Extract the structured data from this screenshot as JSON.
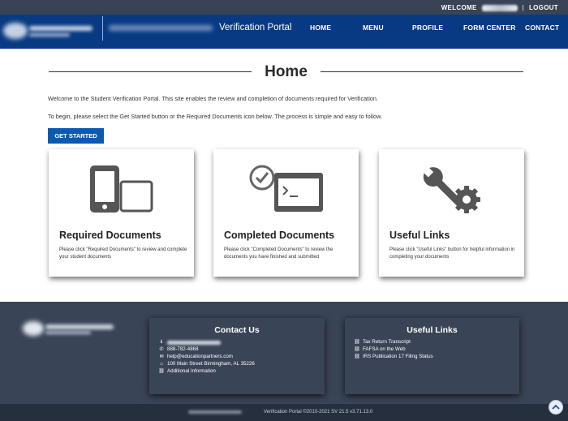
{
  "topbar": {
    "welcome_label": "WELCOME",
    "separator": "|",
    "logout_label": "LOGOUT"
  },
  "header": {
    "portal_title": "Verification Portal"
  },
  "nav": {
    "items": [
      "HOME",
      "MENU",
      "PROFILE",
      "FORM CENTER",
      "CONTACT"
    ]
  },
  "main": {
    "title": "Home",
    "intro_1": "Welcome to the Student Verification Portal. This site enables the review and completion of documents required for Verification.",
    "intro_2": "To begin, please select the Get Started button or the Required Documents icon below. The process is simple and easy to follow.",
    "get_started_label": "GET STARTED",
    "cards": [
      {
        "title": "Required Documents",
        "description": "Please click \"Required Documents\" to review and complete your student documents",
        "icon": "devices-icon"
      },
      {
        "title": "Completed Documents",
        "description": "Please click \"Completed Documents\" to review the documents you have finished and submitted",
        "icon": "check-window-icon"
      },
      {
        "title": "Useful Links",
        "description": "Please click \"Useful Links\" button for helpful information in completing your documents",
        "icon": "wrench-gear-icon"
      }
    ]
  },
  "footer": {
    "contact": {
      "title": "Contact Us",
      "phone": "888-782-4868",
      "email": "help@educationpartners.com",
      "address": "100 Main Street Birmingham, AL 35226",
      "additional": "Additional Information"
    },
    "links": {
      "title": "Useful Links",
      "items": [
        "Tax Return Transcript",
        "FAFSA on the Web",
        "IRS Publication 17 Filing Status"
      ]
    },
    "copyright": "Verification Portal ©2010-2021  SV 21.5  v3.71.13.0"
  },
  "colors": {
    "topbar": "#394356",
    "navbar": "#073a82",
    "button": "#0b5ab0",
    "footer": "#3a4457",
    "bottombar": "#262f3e",
    "icon_gray": "#555555"
  }
}
